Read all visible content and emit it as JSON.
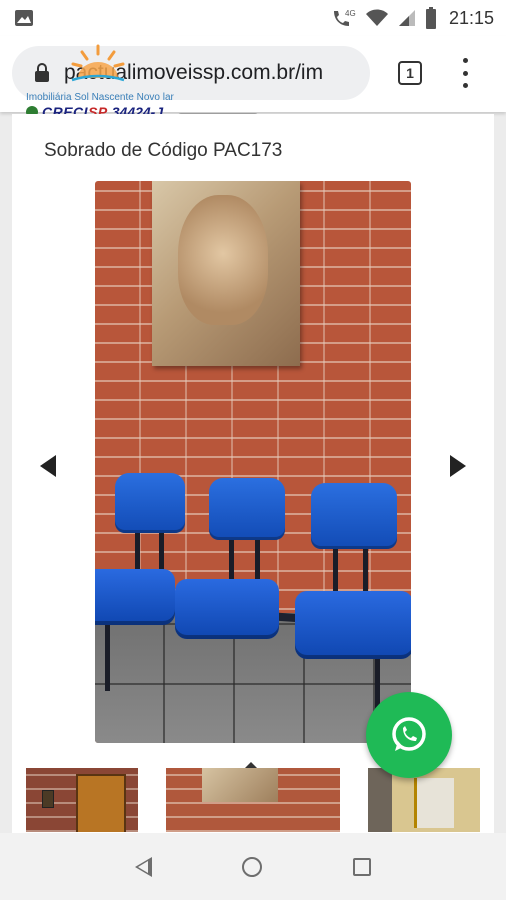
{
  "status_bar": {
    "network": "4G",
    "time": "21:15"
  },
  "browser": {
    "url": "pactualimoveissp.com.br/im",
    "tab_count": "1"
  },
  "site_header": {
    "tagline": "Imobiliária Sol Nascente Novo lar",
    "creci_label": "CRECI",
    "creci_state": "SP",
    "creci_number": "34424-J"
  },
  "listing": {
    "title": "Sobrado de Código PAC173"
  },
  "colors": {
    "whatsapp_green": "#1fba56",
    "seat_blue": "#1a5bd1",
    "brick": "#b8563a"
  }
}
